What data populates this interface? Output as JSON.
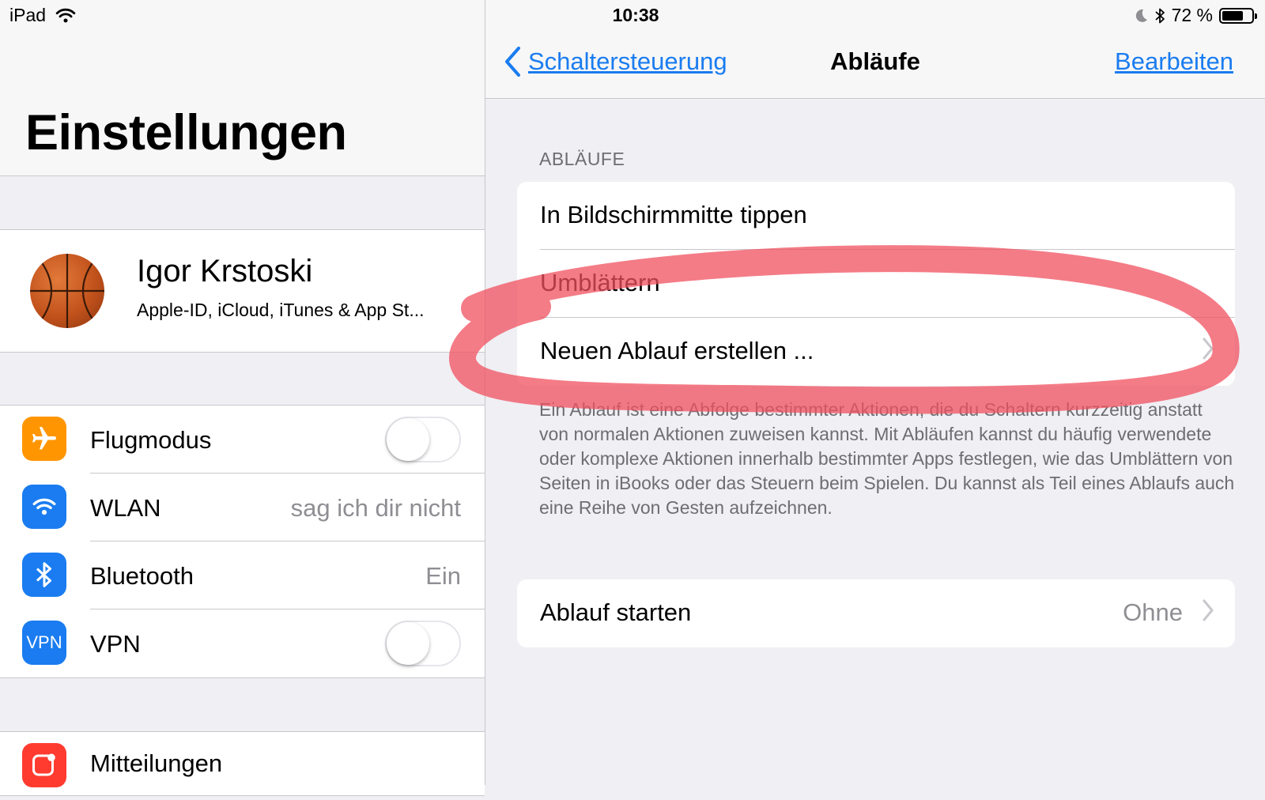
{
  "status_bar": {
    "device": "iPad",
    "time": "10:38",
    "battery_percent": "72 %",
    "battery_level": 0.72,
    "icons": [
      "wifi-icon",
      "moon-icon",
      "bluetooth-icon",
      "battery-icon"
    ]
  },
  "sidebar": {
    "title": "Einstellungen",
    "profile": {
      "name": "Igor Krstoski",
      "subtitle": "Apple-ID, iCloud, iTunes & App St..."
    },
    "items": [
      {
        "label": "Flugmodus",
        "icon": "airplane-icon",
        "icon_color": "#ff9500",
        "type": "toggle",
        "on": false
      },
      {
        "label": "WLAN",
        "icon": "wifi-icon",
        "icon_color": "#1a7cf0",
        "value": "sag ich dir nicht"
      },
      {
        "label": "Bluetooth",
        "icon": "bluetooth-icon",
        "icon_color": "#1a7cf0",
        "value": "Ein"
      },
      {
        "label": "VPN",
        "icon": "vpn-icon",
        "icon_color": "#1a7cf0",
        "icon_text": "VPN",
        "type": "toggle",
        "on": false
      },
      {
        "label": "Mitteilungen",
        "icon": "notifications-icon",
        "icon_color": "#ff3b30"
      }
    ]
  },
  "navbar": {
    "back_label": "Schaltersteuerung",
    "title": "Abläufe",
    "edit_label": "Bearbeiten"
  },
  "main": {
    "section_header": "ABLÄUFE",
    "items": [
      {
        "label": "In Bildschirmmitte tippen"
      },
      {
        "label": "Umblättern"
      },
      {
        "label": "Neuen Ablauf erstellen ..."
      }
    ],
    "footer": "Ein Ablauf ist eine Abfolge bestimmter Aktionen, die du Schaltern kurzzeitig anstatt von normalen Aktionen zuweisen kannst. Mit Abläufen kannst du häufig verwendete oder komplexe Aktionen innerhalb bestimmter Apps festlegen, wie das Umblättern von Seiten in iBooks oder das Steuern beim Spielen. Du kannst als Teil eines Ablaufs auch eine Reihe von Gesten aufzeichnen.",
    "start_row": {
      "label": "Ablauf starten",
      "value": "Ohne"
    }
  },
  "colors": {
    "accent": "#1a7cf0",
    "annotation": "#f0505f"
  }
}
